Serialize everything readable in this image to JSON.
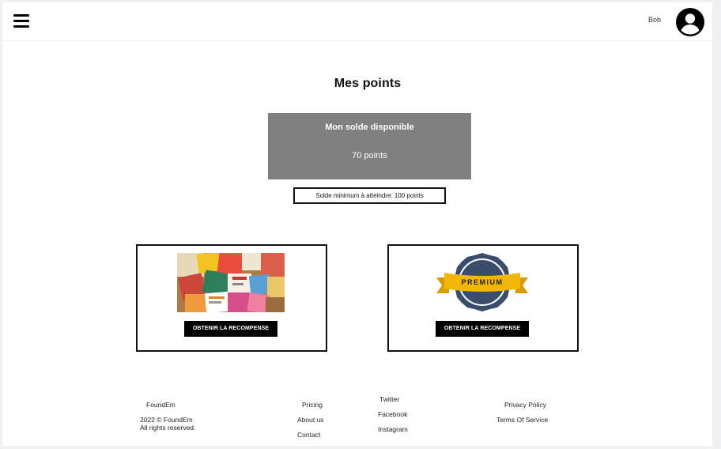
{
  "header": {
    "menu_icon": "hamburger-menu-icon",
    "user_name": "Bob",
    "avatar_icon": "account-circle-icon"
  },
  "main": {
    "title": "Mes points",
    "balance_label": "Mon solde disponible",
    "balance_value": "70 points",
    "minimum_text": "Solde minimum à atteindre: 100 points",
    "rewards": [
      {
        "image": "flyers-collage",
        "button_label": "OBTENIR LA RECOMPENSE"
      },
      {
        "image": "premium-badge",
        "badge_text": "PREMIUM",
        "button_label": "OBTENIR LA RECOMPENSE"
      }
    ]
  },
  "footer": {
    "brand": "FoundEm",
    "copyright_line1": "2022 © FoundEm",
    "copyright_line2": "All rights reserved.",
    "col1": [
      "Pricing",
      "About us",
      "Contact"
    ],
    "col2": [
      "Twitter",
      "Facebook",
      "Instagram"
    ],
    "col3": [
      "Privacy Policy",
      "Terms Of Service"
    ]
  },
  "colors": {
    "balance_bg": "#808080",
    "button_bg": "#000000",
    "badge_navy": "#3a4d6b",
    "ribbon_yellow": "#f2b705"
  }
}
